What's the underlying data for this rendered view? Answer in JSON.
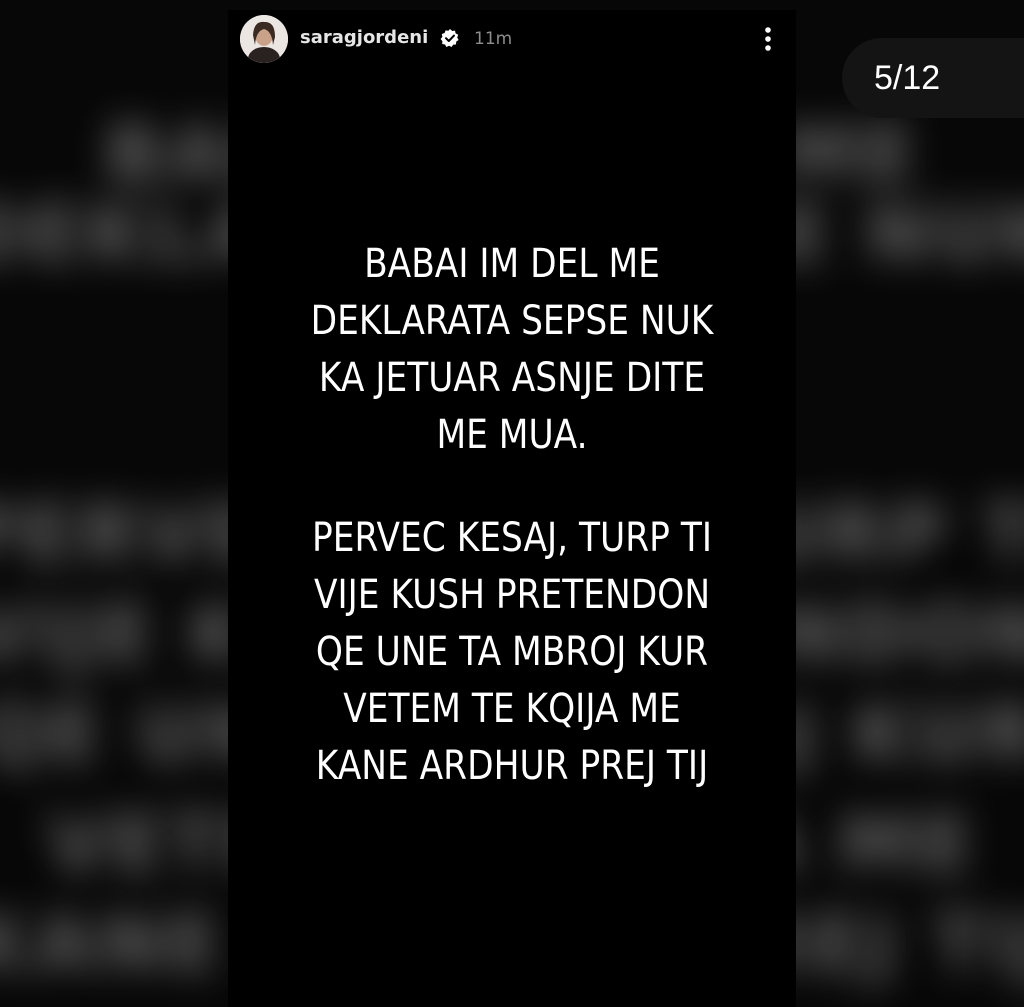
{
  "story": {
    "username": "saragjordeni",
    "time": "11m",
    "text_paragraph_1": [
      "BABAI IM DEL ME",
      "DEKLARATA SEPSE NUK",
      "KA JETUAR ASNJE DITE",
      "ME MUA."
    ],
    "text_paragraph_2": [
      "PERVEC KESAJ, TURP TI",
      "VIJE KUSH PRETENDON",
      "QE UNE TA MBROJ KUR",
      "VETEM TE KQIJA ME",
      "KANE ARDHUR PREJ TIJ"
    ],
    "icons": {
      "verified": "verified-badge-icon",
      "more": "more-options-icon"
    }
  },
  "counter": {
    "label": "5/12"
  },
  "colors": {
    "background": "#000000",
    "text": "#ffffff",
    "counter_pill": "#141414",
    "timestamp": "#8d8d8d"
  }
}
